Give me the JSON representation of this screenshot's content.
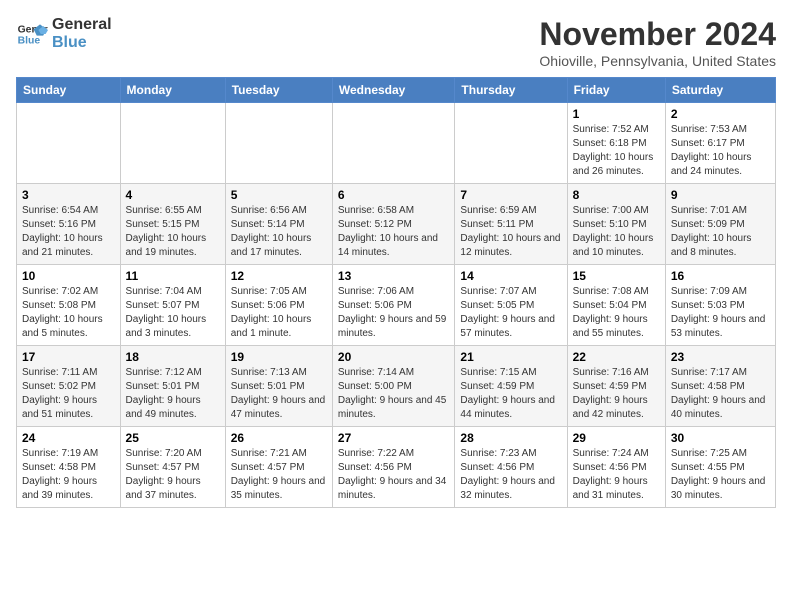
{
  "logo": {
    "line1": "General",
    "line2": "Blue"
  },
  "header": {
    "month": "November 2024",
    "location": "Ohioville, Pennsylvania, United States"
  },
  "weekdays": [
    "Sunday",
    "Monday",
    "Tuesday",
    "Wednesday",
    "Thursday",
    "Friday",
    "Saturday"
  ],
  "weeks": [
    [
      {
        "day": "",
        "info": ""
      },
      {
        "day": "",
        "info": ""
      },
      {
        "day": "",
        "info": ""
      },
      {
        "day": "",
        "info": ""
      },
      {
        "day": "",
        "info": ""
      },
      {
        "day": "1",
        "info": "Sunrise: 7:52 AM\nSunset: 6:18 PM\nDaylight: 10 hours and 26 minutes."
      },
      {
        "day": "2",
        "info": "Sunrise: 7:53 AM\nSunset: 6:17 PM\nDaylight: 10 hours and 24 minutes."
      }
    ],
    [
      {
        "day": "3",
        "info": "Sunrise: 6:54 AM\nSunset: 5:16 PM\nDaylight: 10 hours and 21 minutes."
      },
      {
        "day": "4",
        "info": "Sunrise: 6:55 AM\nSunset: 5:15 PM\nDaylight: 10 hours and 19 minutes."
      },
      {
        "day": "5",
        "info": "Sunrise: 6:56 AM\nSunset: 5:14 PM\nDaylight: 10 hours and 17 minutes."
      },
      {
        "day": "6",
        "info": "Sunrise: 6:58 AM\nSunset: 5:12 PM\nDaylight: 10 hours and 14 minutes."
      },
      {
        "day": "7",
        "info": "Sunrise: 6:59 AM\nSunset: 5:11 PM\nDaylight: 10 hours and 12 minutes."
      },
      {
        "day": "8",
        "info": "Sunrise: 7:00 AM\nSunset: 5:10 PM\nDaylight: 10 hours and 10 minutes."
      },
      {
        "day": "9",
        "info": "Sunrise: 7:01 AM\nSunset: 5:09 PM\nDaylight: 10 hours and 8 minutes."
      }
    ],
    [
      {
        "day": "10",
        "info": "Sunrise: 7:02 AM\nSunset: 5:08 PM\nDaylight: 10 hours and 5 minutes."
      },
      {
        "day": "11",
        "info": "Sunrise: 7:04 AM\nSunset: 5:07 PM\nDaylight: 10 hours and 3 minutes."
      },
      {
        "day": "12",
        "info": "Sunrise: 7:05 AM\nSunset: 5:06 PM\nDaylight: 10 hours and 1 minute."
      },
      {
        "day": "13",
        "info": "Sunrise: 7:06 AM\nSunset: 5:06 PM\nDaylight: 9 hours and 59 minutes."
      },
      {
        "day": "14",
        "info": "Sunrise: 7:07 AM\nSunset: 5:05 PM\nDaylight: 9 hours and 57 minutes."
      },
      {
        "day": "15",
        "info": "Sunrise: 7:08 AM\nSunset: 5:04 PM\nDaylight: 9 hours and 55 minutes."
      },
      {
        "day": "16",
        "info": "Sunrise: 7:09 AM\nSunset: 5:03 PM\nDaylight: 9 hours and 53 minutes."
      }
    ],
    [
      {
        "day": "17",
        "info": "Sunrise: 7:11 AM\nSunset: 5:02 PM\nDaylight: 9 hours and 51 minutes."
      },
      {
        "day": "18",
        "info": "Sunrise: 7:12 AM\nSunset: 5:01 PM\nDaylight: 9 hours and 49 minutes."
      },
      {
        "day": "19",
        "info": "Sunrise: 7:13 AM\nSunset: 5:01 PM\nDaylight: 9 hours and 47 minutes."
      },
      {
        "day": "20",
        "info": "Sunrise: 7:14 AM\nSunset: 5:00 PM\nDaylight: 9 hours and 45 minutes."
      },
      {
        "day": "21",
        "info": "Sunrise: 7:15 AM\nSunset: 4:59 PM\nDaylight: 9 hours and 44 minutes."
      },
      {
        "day": "22",
        "info": "Sunrise: 7:16 AM\nSunset: 4:59 PM\nDaylight: 9 hours and 42 minutes."
      },
      {
        "day": "23",
        "info": "Sunrise: 7:17 AM\nSunset: 4:58 PM\nDaylight: 9 hours and 40 minutes."
      }
    ],
    [
      {
        "day": "24",
        "info": "Sunrise: 7:19 AM\nSunset: 4:58 PM\nDaylight: 9 hours and 39 minutes."
      },
      {
        "day": "25",
        "info": "Sunrise: 7:20 AM\nSunset: 4:57 PM\nDaylight: 9 hours and 37 minutes."
      },
      {
        "day": "26",
        "info": "Sunrise: 7:21 AM\nSunset: 4:57 PM\nDaylight: 9 hours and 35 minutes."
      },
      {
        "day": "27",
        "info": "Sunrise: 7:22 AM\nSunset: 4:56 PM\nDaylight: 9 hours and 34 minutes."
      },
      {
        "day": "28",
        "info": "Sunrise: 7:23 AM\nSunset: 4:56 PM\nDaylight: 9 hours and 32 minutes."
      },
      {
        "day": "29",
        "info": "Sunrise: 7:24 AM\nSunset: 4:56 PM\nDaylight: 9 hours and 31 minutes."
      },
      {
        "day": "30",
        "info": "Sunrise: 7:25 AM\nSunset: 4:55 PM\nDaylight: 9 hours and 30 minutes."
      }
    ]
  ]
}
